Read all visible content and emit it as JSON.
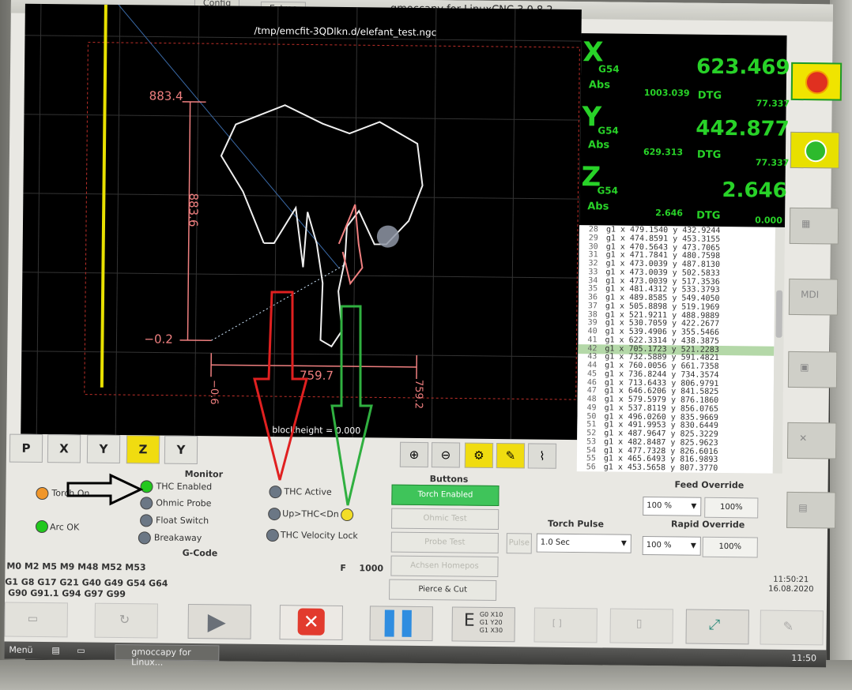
{
  "window": {
    "title": "gmoccapy for LinuxCNC  3.0.8.2",
    "tabs": [
      "Config",
      "Extras"
    ]
  },
  "preview": {
    "file": "/tmp/emcfit-3QDlkn.d/elefant_test.ngc",
    "block_height": "blockheight = 0.000",
    "dims": {
      "top": "883.4",
      "height": "883.6",
      "bottom": "−0.2",
      "width": "759.7",
      "x_left": "−0.6",
      "x_right": "759.2"
    }
  },
  "dro": {
    "x": {
      "axis": "X",
      "system": "G54",
      "abs_label": "Abs",
      "value": "623.469",
      "abs": "1003.039",
      "dtg_label": "DTG",
      "dtg": "77.337"
    },
    "y": {
      "axis": "Y",
      "system": "G54",
      "abs_label": "Abs",
      "value": "442.877",
      "abs": "629.313",
      "dtg_label": "DTG",
      "dtg": "77.337"
    },
    "z": {
      "axis": "Z",
      "system": "G54",
      "abs_label": "Abs",
      "value": "2.646",
      "abs": "2.646",
      "dtg_label": "DTG",
      "dtg": "0.000"
    }
  },
  "gcode": [
    {
      "n": "28",
      "t": "g1 x 479.1540 y 432.9244"
    },
    {
      "n": "29",
      "t": "g1 x 474.8591 y 453.3155"
    },
    {
      "n": "30",
      "t": "g1 x 470.5643 y 473.7065"
    },
    {
      "n": "31",
      "t": "g1 x 471.7841 y 480.7598"
    },
    {
      "n": "32",
      "t": "g1 x 473.0039 y 487.8130"
    },
    {
      "n": "33",
      "t": "g1 x 473.0039 y 502.5833"
    },
    {
      "n": "34",
      "t": "g1 x 473.0039 y 517.3536"
    },
    {
      "n": "35",
      "t": "g1 x 481.4312 y 533.3793"
    },
    {
      "n": "36",
      "t": "g1 x 489.8585 y 549.4050"
    },
    {
      "n": "37",
      "t": "g1 x 505.8898 y 519.1969"
    },
    {
      "n": "38",
      "t": "g1 x 521.9211 y 488.9889"
    },
    {
      "n": "39",
      "t": "g1 x 530.7059 y 422.2677"
    },
    {
      "n": "40",
      "t": "g1 x 539.4906 y 355.5466"
    },
    {
      "n": "41",
      "t": "g1 x 622.3314 y 438.3875"
    },
    {
      "n": "42",
      "t": "g1 x 705.1723 y 521.2283"
    },
    {
      "n": "43",
      "t": "g1 x 732.5889 y 591.4821"
    },
    {
      "n": "44",
      "t": "g1 x 760.0056 y 661.7358"
    },
    {
      "n": "45",
      "t": "g1 x 736.8244 y 734.3574"
    },
    {
      "n": "46",
      "t": "g1 x 713.6433 y 806.9791"
    },
    {
      "n": "47",
      "t": "g1 x 646.6206 y 841.5825"
    },
    {
      "n": "48",
      "t": "g1 x 579.5979 y 876.1860"
    },
    {
      "n": "49",
      "t": "g1 x 537.8119 y 856.0765"
    },
    {
      "n": "50",
      "t": "g1 x 496.0260 y 835.9669"
    },
    {
      "n": "51",
      "t": "g1 x 491.9953 y 830.6449"
    },
    {
      "n": "52",
      "t": "g1 x 487.9647 y 825.3229"
    },
    {
      "n": "53",
      "t": "g1 x 482.8487 y 825.9623"
    },
    {
      "n": "54",
      "t": "g1 x 477.7328 y 826.6016"
    },
    {
      "n": "55",
      "t": "g1 x 465.6493 y 816.9893"
    },
    {
      "n": "56",
      "t": "g1 x 453.5658 y 807.3770"
    }
  ],
  "side": {
    "mdi": "MDI"
  },
  "view_buttons": [
    "P",
    "X",
    "Y",
    "Z",
    "Y"
  ],
  "monitor": {
    "title": "Monitor",
    "torch_on": "Torch On",
    "arc_ok": "Arc OK",
    "thc_enabled": "THC Enabled",
    "ohmic_probe": "Ohmic Probe",
    "float_switch": "Float Switch",
    "breakaway": "Breakaway",
    "thc_active": "THC Active",
    "up_dn": "Up>THC<Dn",
    "velocity_lock": "THC Velocity Lock"
  },
  "buttons": {
    "title": "Buttons",
    "torch_enabled": "Torch Enabled",
    "ohmic_test": "Ohmic Test",
    "probe_test": "Probe Test",
    "home": "Achsen Homepos anfahren",
    "pierce": "Pierce & Cut"
  },
  "torch_pulse": {
    "title": "Torch Pulse",
    "pulse": "Pulse",
    "value": "1.0 Sec"
  },
  "feed_override": {
    "title": "Feed Override",
    "value": "100 %",
    "pct": "100%"
  },
  "rapid_override": {
    "title": "Rapid Override",
    "value": "100 %",
    "pct": "100%"
  },
  "gcode_state": {
    "title": "G-Code",
    "m_codes": "M0 M2 M5 M9 M48 M52 M53",
    "g_codes_1": "G1 G8 G17 G21 G40 G49 G54 G64",
    "g_codes_2": "G90 G91.1 G94 G97 G99",
    "feed_label": "F",
    "feed_value": "1000"
  },
  "clock": {
    "time": "11:50:21",
    "date": "16.08.2020"
  },
  "edit_btn": {
    "lines": [
      "G0 X10",
      "G1 Y20",
      "G1 X30"
    ]
  },
  "taskbar": {
    "menu": "Menü",
    "app": "gmoccapy for Linux...",
    "time": "11:50"
  },
  "colors": {
    "dro_green": "#28d228",
    "preview_bg": "#000000",
    "dim_red": "#f08080",
    "thc_green": "#3fc45a",
    "estop_yellow": "#f0e400"
  }
}
